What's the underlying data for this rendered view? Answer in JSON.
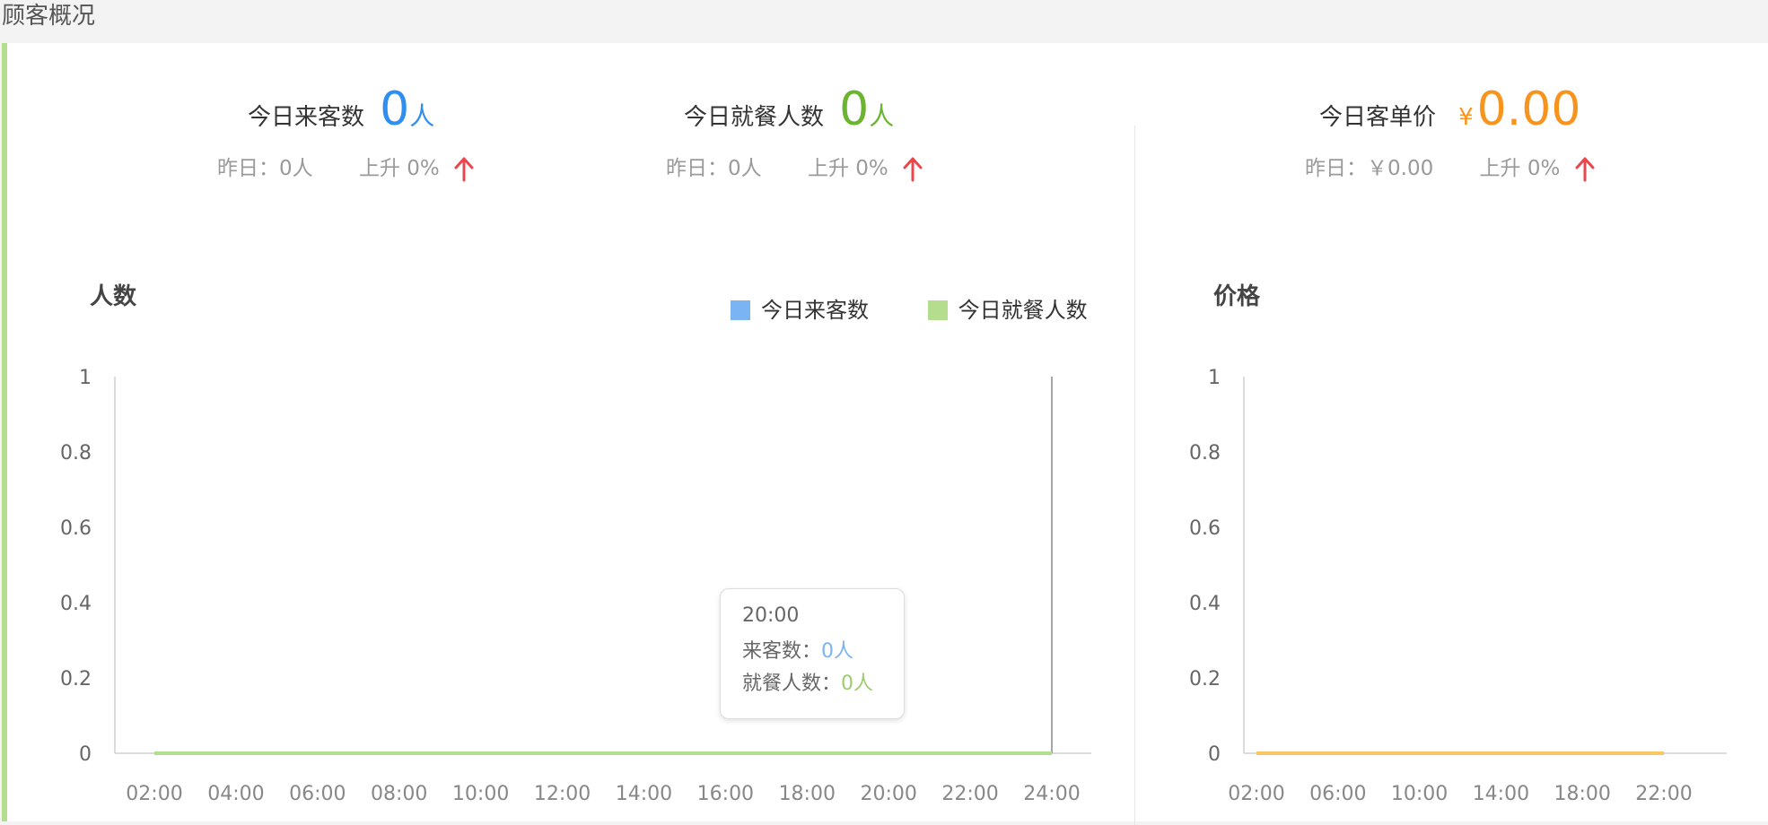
{
  "section_title": "顾客概况",
  "colors": {
    "blue": "#2f8ff0",
    "green": "#6ab52d",
    "orange": "#f7941d",
    "red": "#e8474d",
    "visitors_series": "#7ab4f2",
    "diners_series": "#b4dd8d",
    "price_series": "#f9c565",
    "panel_accent": "#b4dd8d"
  },
  "stats": {
    "visitors": {
      "label": "今日来客数",
      "value": "0",
      "unit": "人",
      "yesterday": "昨日：0人",
      "change": "上升 0%",
      "trend_icon": "arrow-up-icon"
    },
    "diners": {
      "label": "今日就餐人数",
      "value": "0",
      "unit": "人",
      "yesterday": "昨日：0人",
      "change": "上升 0%",
      "trend_icon": "arrow-up-icon"
    },
    "avg_price": {
      "label": "今日客单价",
      "currency": "¥",
      "value": "0.00",
      "yesterday": "昨日：￥0.00",
      "change": "上升 0%",
      "trend_icon": "arrow-up-icon"
    }
  },
  "legend": {
    "visitors": "今日来客数",
    "diners": "今日就餐人数"
  },
  "tooltip": {
    "time": "20:00",
    "visitors_label": "来客数：",
    "visitors_value": "0人",
    "diners_label": "就餐人数：",
    "diners_value": "0人"
  },
  "chart_data": [
    {
      "type": "line",
      "title": "",
      "ylabel": "人数",
      "xlabel": "",
      "ylim": [
        0,
        1
      ],
      "y_ticks": [
        "0",
        "0.2",
        "0.4",
        "0.6",
        "0.8",
        "1"
      ],
      "categories": [
        "02:00",
        "04:00",
        "06:00",
        "08:00",
        "10:00",
        "12:00",
        "14:00",
        "16:00",
        "18:00",
        "20:00",
        "22:00",
        "24:00"
      ],
      "series": [
        {
          "name": "今日来客数",
          "values": [
            0,
            0,
            0,
            0,
            0,
            0,
            0,
            0,
            0,
            0,
            0,
            0
          ]
        },
        {
          "name": "今日就餐人数",
          "values": [
            0,
            0,
            0,
            0,
            0,
            0,
            0,
            0,
            0,
            0,
            0,
            0
          ]
        }
      ],
      "grid": false,
      "legend_position": "top-right"
    },
    {
      "type": "line",
      "title": "",
      "ylabel": "价格",
      "xlabel": "",
      "ylim": [
        0,
        1
      ],
      "y_ticks": [
        "0",
        "0.2",
        "0.4",
        "0.6",
        "0.8",
        "1"
      ],
      "categories": [
        "02:00",
        "06:00",
        "10:00",
        "14:00",
        "18:00",
        "22:00"
      ],
      "series": [
        {
          "values": [
            0,
            0,
            0,
            0,
            0,
            0
          ]
        }
      ],
      "grid": false
    }
  ]
}
